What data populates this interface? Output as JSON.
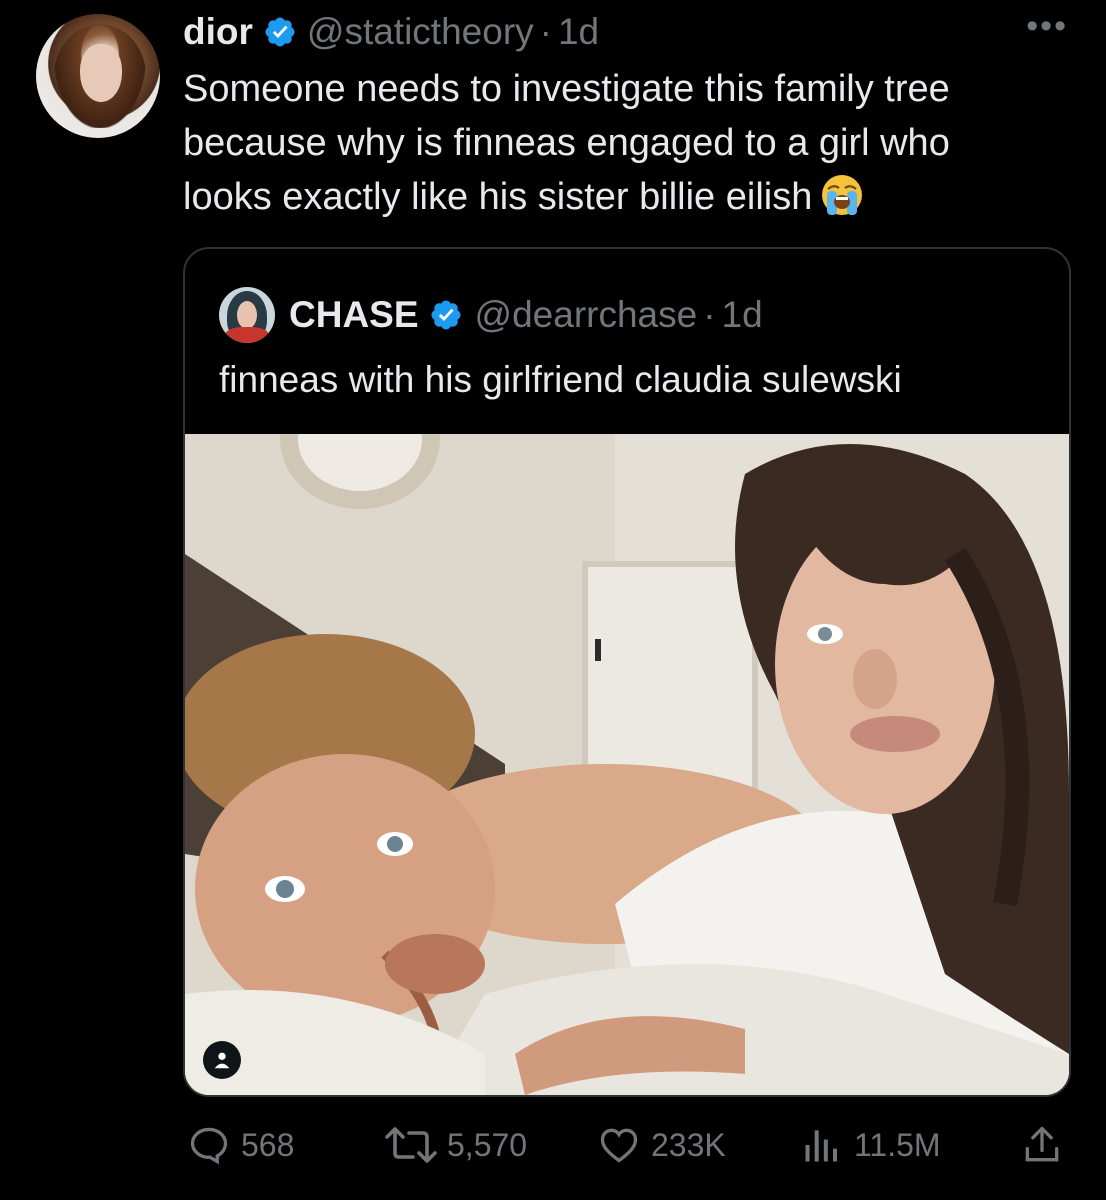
{
  "tweet": {
    "display_name": "dior",
    "handle": "@statictheory",
    "separator": "·",
    "time": "1d",
    "more": "•••",
    "lines": [
      "Someone needs to investigate this family tree",
      "because why is finneas engaged to a girl who",
      "looks exactly like his sister billie eilish"
    ],
    "emoji": "loudly-crying-face"
  },
  "quote": {
    "display_name": "CHASE",
    "handle": "@dearrchase",
    "separator": "·",
    "time": "1d",
    "text": "finneas with his girlfriend claudia sulewski"
  },
  "actions": {
    "replies": "568",
    "retweets": "5,570",
    "likes": "233K",
    "views": "11.5M"
  },
  "colors": {
    "background": "#000000",
    "text": "#e7e9ea",
    "secondary": "#71767b",
    "verified": "#1d9bf0",
    "border": "#2f3336"
  }
}
